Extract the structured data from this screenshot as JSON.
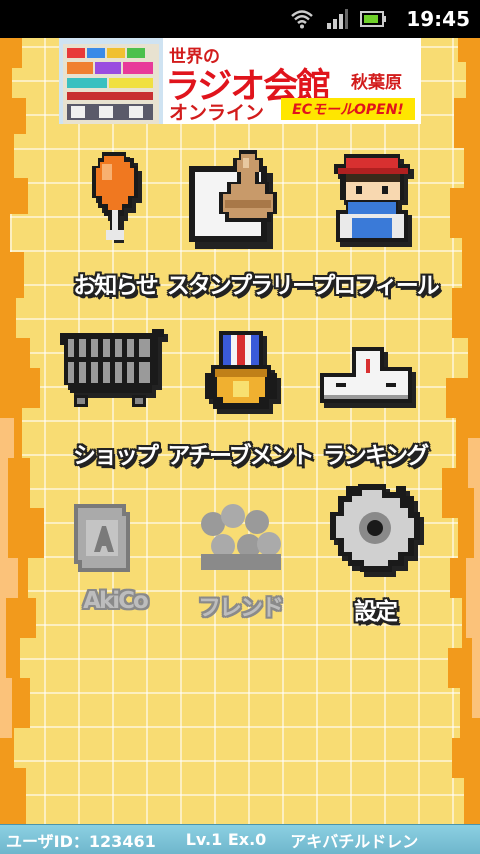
{
  "status_bar": {
    "time": "19:45",
    "icons": [
      "wifi-icon",
      "signal-icon",
      "battery-icon"
    ]
  },
  "banner": {
    "line1": "世界の",
    "title": "ラジオ会館",
    "location": "秋葉原",
    "online": "オンライン",
    "ec": "ECモールOPEN!"
  },
  "menu": {
    "items": [
      {
        "label": "お知らせ",
        "icon": "drumstick-icon",
        "enabled": true
      },
      {
        "label": "スタンプラリー",
        "icon": "stamp-icon",
        "enabled": true
      },
      {
        "label": "プロフィール",
        "icon": "avatar-icon",
        "enabled": true
      },
      {
        "label": "ショップ",
        "icon": "shopping-cart-icon",
        "enabled": true
      },
      {
        "label": "アチーブメント",
        "icon": "medal-icon",
        "enabled": true
      },
      {
        "label": "ランキング",
        "icon": "podium-icon",
        "enabled": true
      },
      {
        "label": "AkiCo",
        "icon": "card-icon",
        "enabled": false
      },
      {
        "label": "フレンド",
        "icon": "friends-icon",
        "enabled": false
      },
      {
        "label": "設定",
        "icon": "gear-icon",
        "enabled": true
      }
    ]
  },
  "footer": {
    "user": "ユーザID：123461",
    "level": "Lv.1 Ex.0",
    "name": "アキバチルドレン"
  },
  "colors": {
    "background": "#f8dc73",
    "edge": "#f29a1c",
    "footer": "#7fc4d8"
  }
}
